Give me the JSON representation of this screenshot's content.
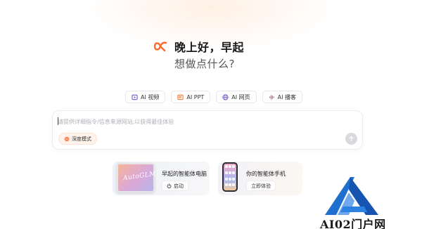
{
  "brand": {
    "greeting": "晚上好，早起",
    "subtitle": "想做点什么?",
    "accent": "#ff6a2b"
  },
  "modes": [
    {
      "label": "AI 视频",
      "icon": "video-icon",
      "color": "#6b5bd6"
    },
    {
      "label": "AI PPT",
      "icon": "ppt-icon",
      "color": "#f07a3a"
    },
    {
      "label": "AI 网页",
      "icon": "web-icon",
      "color": "#7b56d8"
    },
    {
      "label": "AI 播客",
      "icon": "podcast-icon",
      "color": "#e0527a"
    }
  ],
  "composer": {
    "placeholder": "请提供详细指令/信息来源网站,以获得最佳体验",
    "value": "",
    "deep_mode_label": "深度模式"
  },
  "products": [
    {
      "title": "早起的智能体电脑",
      "button_label": "启动",
      "thumb_text": "AutoGLM"
    },
    {
      "title": "你的智能体手机",
      "button_label": "立即体验"
    }
  ],
  "watermark": {
    "text": "AI02门户网"
  }
}
